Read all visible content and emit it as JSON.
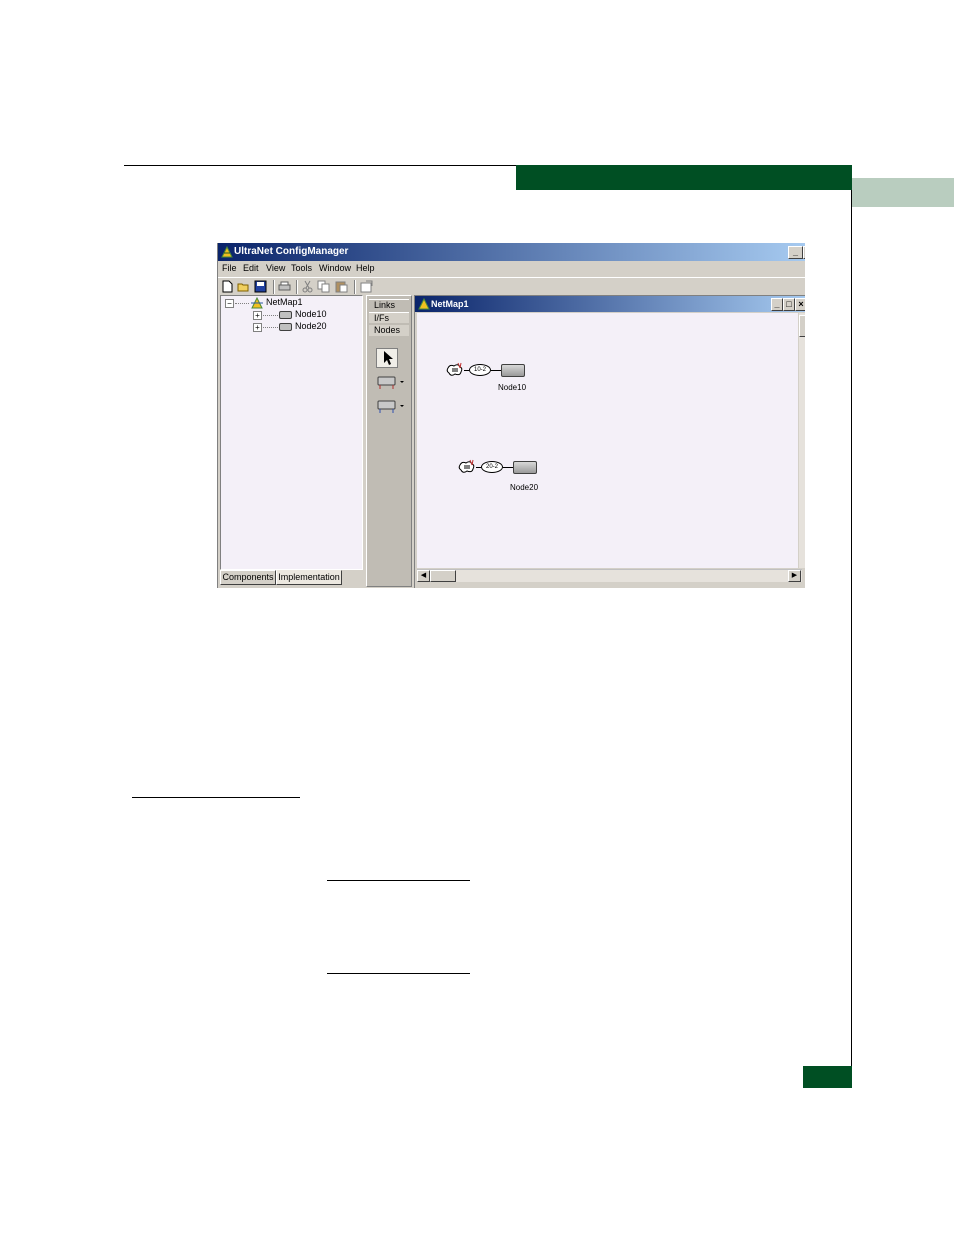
{
  "app": {
    "title": "UltraNet ConfigManager",
    "caption_buttons": [
      "_",
      "□"
    ],
    "menu": [
      "File",
      "Edit",
      "View",
      "Tools",
      "Window",
      "Help"
    ],
    "toolbar_icons": [
      "new-icon",
      "open-icon",
      "save-icon",
      "print-icon",
      "cut-icon",
      "copy-icon",
      "paste-icon",
      "properties-icon"
    ]
  },
  "tree": {
    "root": "NetMap1",
    "children": [
      "Node10",
      "Node20"
    ],
    "expander_collapsed": "+",
    "expander_expanded": "−"
  },
  "bottom_tabs": [
    "Components",
    "Implementation"
  ],
  "palette": {
    "tabs": [
      "Links",
      "I/Fs",
      "Nodes"
    ],
    "tool_icons": [
      "pointer-icon",
      "node-type-1-icon",
      "node-type-2-icon"
    ]
  },
  "netmap": {
    "title": "NetMap1",
    "caption_buttons": [
      "_",
      "□",
      "×"
    ],
    "nodes": [
      {
        "interface": "10-2",
        "label": "Node10"
      },
      {
        "interface": "20-2",
        "label": "Node20"
      }
    ]
  }
}
